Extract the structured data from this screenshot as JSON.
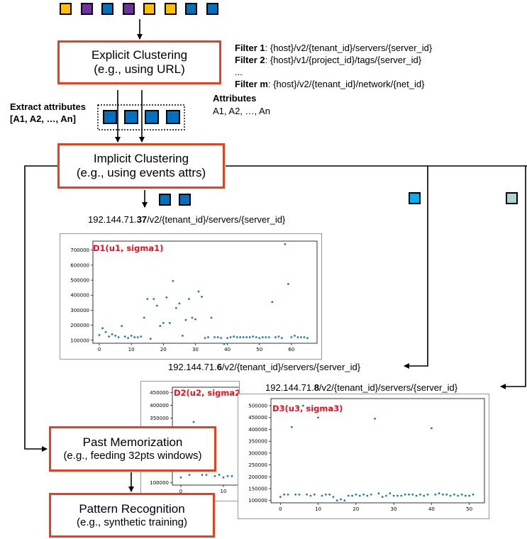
{
  "colors": {
    "accent": "#e8401c",
    "title_red": "#e8101c",
    "point_blue": "#1f77b4",
    "yellow": "#ffc000",
    "purple": "#7030a0",
    "blue": "#0070c0",
    "cyan": "#00b0f0",
    "light_teal": "#a9d3d5"
  },
  "input_squares": [
    "yellow",
    "purple",
    "blue",
    "purple",
    "yellow",
    "yellow",
    "blue",
    "blue"
  ],
  "explicit": {
    "title": "Explicit Clustering",
    "subtitle": "(e.g., using URL)"
  },
  "filters": [
    {
      "label": "Filter 1",
      "text": ": {host}/v2/{tenant_id}/servers/{server_id}"
    },
    {
      "label": "Filter 2",
      "text": ": {host}/v1/{project_id}/tags/{server_id}"
    },
    {
      "label": "",
      "text": "..."
    },
    {
      "label": "Filter m",
      "text": ": {host}/v2/{tenant_id}/network/{net_id}"
    }
  ],
  "extract": {
    "line1": "Extract attributes",
    "line2": "[A1, A2, …, An]"
  },
  "attributes": {
    "title": "Attributes",
    "list": "A1, A2, …, An"
  },
  "implicit": {
    "title": "Implicit Clustering",
    "subtitle": "(e.g., using events attrs)"
  },
  "past": {
    "title": "Past Memorization",
    "subtitle": "(e.g., feeding 32pts windows)"
  },
  "pattern": {
    "title": "Pattern Recognition",
    "subtitle": "(e.g., synthetic training)"
  },
  "url1": {
    "prefix": "192.144.71.",
    "bold": "37",
    "suffix": "/v2/{tenant_id}/servers/{server_id}"
  },
  "url2": {
    "prefix": "192.144.71.",
    "bold": "6",
    "suffix": "/v2/{tenant_id}/servers/{server_id}"
  },
  "url3": {
    "prefix": "192.144.71.",
    "bold": "8",
    "suffix": "/v2/{tenant_id}/servers/{server_id}"
  },
  "chart_data": [
    {
      "type": "scatter",
      "title": "D1(u1, sigma1)",
      "xlim": [
        -2,
        68
      ],
      "ylim": [
        80000,
        760000
      ],
      "xticks": [
        0,
        10,
        20,
        30,
        40,
        50,
        60
      ],
      "yticks": [
        100000,
        200000,
        300000,
        400000,
        500000,
        600000,
        700000
      ],
      "ytick_labels": [
        "100000",
        "200000",
        "300000",
        "400000",
        "500000",
        "600000",
        "700000"
      ],
      "points": [
        [
          0,
          135000
        ],
        [
          1,
          180000
        ],
        [
          2,
          155000
        ],
        [
          3,
          125000
        ],
        [
          4,
          140000
        ],
        [
          5,
          130000
        ],
        [
          6,
          120000
        ],
        [
          7,
          195000
        ],
        [
          8,
          125000
        ],
        [
          9,
          115000
        ],
        [
          10,
          130000
        ],
        [
          11,
          120000
        ],
        [
          12,
          120000
        ],
        [
          13,
          125000
        ],
        [
          14,
          250000
        ],
        [
          15,
          375000
        ],
        [
          16,
          110000
        ],
        [
          17,
          375000
        ],
        [
          18,
          330000
        ],
        [
          19,
          195000
        ],
        [
          20,
          215000
        ],
        [
          21,
          385000
        ],
        [
          22,
          215000
        ],
        [
          23,
          495000
        ],
        [
          24,
          315000
        ],
        [
          25,
          345000
        ],
        [
          26,
          130000
        ],
        [
          27,
          235000
        ],
        [
          28,
          375000
        ],
        [
          29,
          250000
        ],
        [
          30,
          240000
        ],
        [
          31,
          425000
        ],
        [
          32,
          390000
        ],
        [
          33,
          115000
        ],
        [
          34,
          120000
        ],
        [
          35,
          250000
        ],
        [
          36,
          120000
        ],
        [
          37,
          120000
        ],
        [
          38,
          115000
        ],
        [
          39,
          75000
        ],
        [
          40,
          115000
        ],
        [
          41,
          120000
        ],
        [
          42,
          125000
        ],
        [
          43,
          120000
        ],
        [
          44,
          120000
        ],
        [
          45,
          120000
        ],
        [
          46,
          120000
        ],
        [
          47,
          120000
        ],
        [
          48,
          125000
        ],
        [
          49,
          120000
        ],
        [
          50,
          115000
        ],
        [
          51,
          120000
        ],
        [
          52,
          120000
        ],
        [
          53,
          120000
        ],
        [
          54,
          355000
        ],
        [
          55,
          120000
        ],
        [
          56,
          125000
        ],
        [
          57,
          115000
        ],
        [
          58,
          740000
        ],
        [
          59,
          475000
        ],
        [
          60,
          120000
        ],
        [
          61,
          130000
        ],
        [
          62,
          120000
        ],
        [
          63,
          120000
        ],
        [
          64,
          120000
        ],
        [
          65,
          115000
        ]
      ]
    },
    {
      "type": "scatter",
      "title": "D2(u2, sigma2)",
      "xlim": [
        -2,
        14
      ],
      "ylim": [
        90000,
        470000
      ],
      "xticks": [
        0,
        10
      ],
      "yticks": [
        100000,
        150000,
        200000,
        250000,
        300000,
        350000,
        400000,
        450000
      ],
      "ytick_labels": [
        "100000",
        "150000",
        "200000",
        "250000",
        "300000",
        "350000",
        "400000",
        "450000"
      ],
      "points": [
        [
          0,
          120000
        ],
        [
          2,
          130000
        ],
        [
          3,
          335000
        ],
        [
          4,
          170000
        ],
        [
          5,
          130000
        ],
        [
          6,
          130000
        ],
        [
          8,
          125000
        ],
        [
          9,
          130000
        ],
        [
          10,
          120000
        ],
        [
          11,
          125000
        ],
        [
          12,
          125000
        ]
      ]
    },
    {
      "type": "scatter",
      "title": "D3(u3, sigma3)",
      "xlim": [
        -2.5,
        54
      ],
      "ylim": [
        90000,
        530000
      ],
      "xticks": [
        0,
        10,
        20,
        30,
        40,
        50
      ],
      "yticks": [
        100000,
        150000,
        200000,
        250000,
        300000,
        350000,
        400000,
        450000,
        500000
      ],
      "ytick_labels": [
        "100000",
        "150000",
        "200000",
        "250000",
        "300000",
        "350000",
        "400000",
        "450000",
        "500000"
      ],
      "points": [
        [
          0,
          115000
        ],
        [
          1,
          125000
        ],
        [
          2,
          125000
        ],
        [
          3,
          410000
        ],
        [
          4,
          125000
        ],
        [
          5,
          125000
        ],
        [
          6,
          500000
        ],
        [
          7,
          125000
        ],
        [
          8,
          120000
        ],
        [
          9,
          125000
        ],
        [
          10,
          450000
        ],
        [
          11,
          120000
        ],
        [
          12,
          125000
        ],
        [
          13,
          125000
        ],
        [
          14,
          115000
        ],
        [
          15,
          100000
        ],
        [
          16,
          105000
        ],
        [
          17,
          100000
        ],
        [
          18,
          120000
        ],
        [
          19,
          120000
        ],
        [
          20,
          125000
        ],
        [
          21,
          120000
        ],
        [
          22,
          125000
        ],
        [
          23,
          120000
        ],
        [
          24,
          125000
        ],
        [
          25,
          445000
        ],
        [
          26,
          130000
        ],
        [
          27,
          115000
        ],
        [
          28,
          120000
        ],
        [
          29,
          130000
        ],
        [
          30,
          120000
        ],
        [
          31,
          120000
        ],
        [
          32,
          120000
        ],
        [
          33,
          125000
        ],
        [
          34,
          125000
        ],
        [
          35,
          125000
        ],
        [
          36,
          120000
        ],
        [
          37,
          125000
        ],
        [
          38,
          120000
        ],
        [
          39,
          125000
        ],
        [
          40,
          405000
        ],
        [
          41,
          125000
        ],
        [
          42,
          130000
        ],
        [
          43,
          125000
        ],
        [
          44,
          125000
        ],
        [
          45,
          120000
        ],
        [
          46,
          125000
        ],
        [
          47,
          120000
        ],
        [
          48,
          125000
        ],
        [
          49,
          120000
        ],
        [
          50,
          120000
        ],
        [
          51,
          125000
        ]
      ]
    }
  ]
}
